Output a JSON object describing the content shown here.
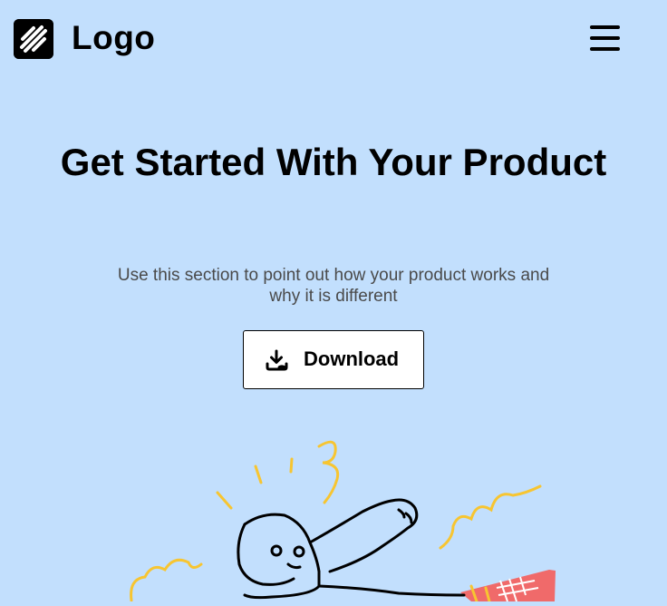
{
  "header": {
    "logo_text": "Logo",
    "logo_icon": "striped-square-logo",
    "menu_icon": "hamburger-menu-icon"
  },
  "hero": {
    "title": "Get Started With Your Product",
    "subtitle": "Use this section to point out how your product works and why it is different",
    "download_label": "Download",
    "download_icon": "download-icon"
  },
  "colors": {
    "background": "#c2dffd",
    "text": "#000000",
    "subtitle_text": "#4a4a4a",
    "button_bg": "#ffffff",
    "accent_yellow": "#f7c531",
    "accent_red": "#f06a6a"
  },
  "illustration": {
    "name": "person-flying-illustration"
  }
}
